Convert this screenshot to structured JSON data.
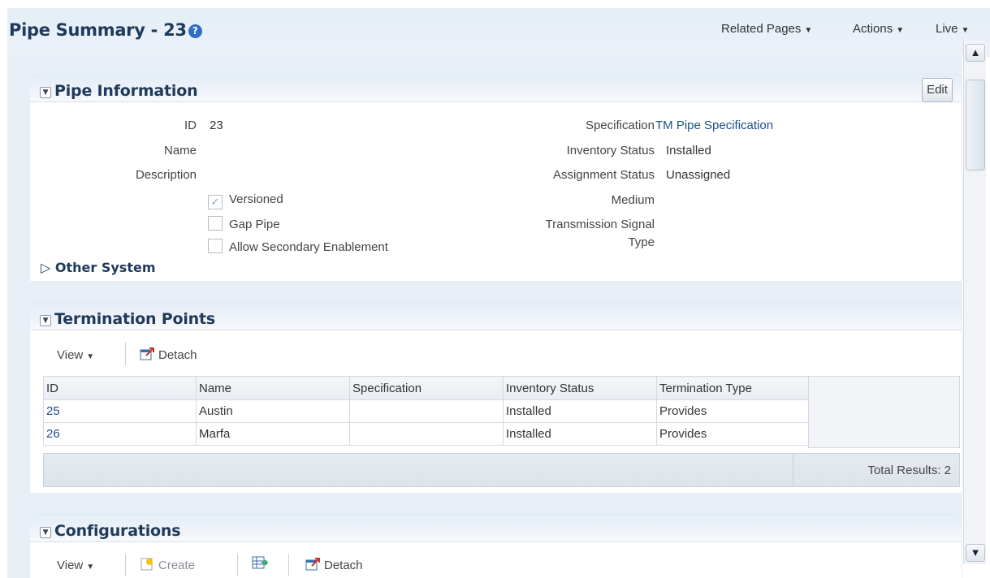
{
  "header": {
    "title": "Pipe Summary - 23",
    "menus": [
      "Related Pages",
      "Actions",
      "Live"
    ]
  },
  "pipe_information": {
    "section_title": "Pipe Information",
    "edit_label": "Edit",
    "left_fields": [
      {
        "label": "ID",
        "value": "23"
      },
      {
        "label": "Name",
        "value": ""
      },
      {
        "label": "Description",
        "value": ""
      }
    ],
    "checkboxes": [
      {
        "label": "Versioned",
        "checked": true
      },
      {
        "label": "Gap Pipe",
        "checked": false
      },
      {
        "label": "Allow Secondary Enablement",
        "checked": false
      }
    ],
    "right_fields": [
      {
        "label": "Specification",
        "value": "TM Pipe Specification"
      },
      {
        "label": "Inventory Status",
        "value": "Installed"
      },
      {
        "label": "Assignment Status",
        "value": "Unassigned"
      },
      {
        "label": "Medium",
        "value": ""
      },
      {
        "label": "Transmission Signal",
        "value": ""
      },
      {
        "label": "Type",
        "value": ""
      }
    ],
    "other_system": "Other System"
  },
  "termination_points": {
    "section_title": "Termination Points",
    "toolbar": {
      "view": "View",
      "detach": "Detach"
    },
    "columns": [
      "ID",
      "Name",
      "Specification",
      "Inventory Status",
      "Termination Type"
    ],
    "rows": [
      [
        "25",
        "Austin",
        "",
        "Installed",
        "Provides"
      ],
      [
        "26",
        "Marfa",
        "",
        "Installed",
        "Provides"
      ]
    ],
    "total": "Total Results: 2"
  },
  "configurations": {
    "section_title": "Configurations",
    "toolbar": {
      "view": "View",
      "create": "Create",
      "detach": "Detach"
    }
  },
  "colors": {
    "title": "#1f3a5a",
    "link": "#1d4f8a",
    "background": "#e8eff6"
  }
}
